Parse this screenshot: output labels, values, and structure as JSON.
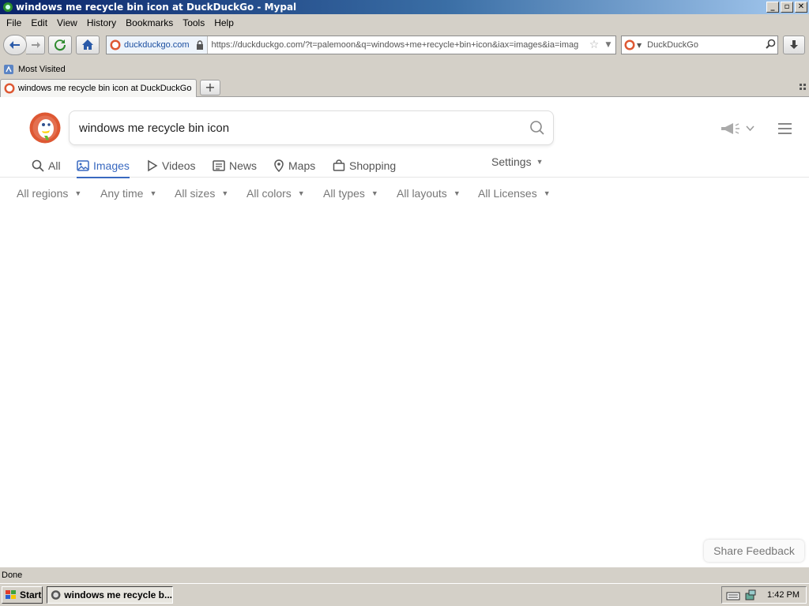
{
  "window": {
    "title": "windows me recycle bin icon at DuckDuckGo - Mypal",
    "buttons": {
      "minimize": "_",
      "maximize": "▫",
      "close": "✕"
    }
  },
  "menu": [
    "File",
    "Edit",
    "View",
    "History",
    "Bookmarks",
    "Tools",
    "Help"
  ],
  "navbar": {
    "identity_domain": "duckduckgo.com",
    "url": "https://duckduckgo.com/?t=palemoon&q=windows+me+recycle+bin+icon&iax=images&ia=imag",
    "search_engine": "DuckDuckGo"
  },
  "bookmarks": {
    "most_visited": "Most Visited"
  },
  "tabs": [
    {
      "label": "windows me recycle bin icon at DuckDuckGo"
    }
  ],
  "new_tab": "+",
  "ddg": {
    "query": "windows me recycle bin icon",
    "nav_tabs": [
      "All",
      "Images",
      "Videos",
      "News",
      "Maps",
      "Shopping"
    ],
    "active_tab": "Images",
    "settings": "Settings",
    "filters": [
      "All regions",
      "Any time",
      "All sizes",
      "All colors",
      "All types",
      "All layouts",
      "All Licenses"
    ],
    "share_feedback": "Share Feedback"
  },
  "status": "Done",
  "taskbar": {
    "start": "Start",
    "task": "windows me recycle b...",
    "clock": "1:42 PM"
  },
  "colors": {
    "accent": "#3969c0",
    "titlebar_start": "#0a246a",
    "ddg_orange": "#de5833"
  }
}
